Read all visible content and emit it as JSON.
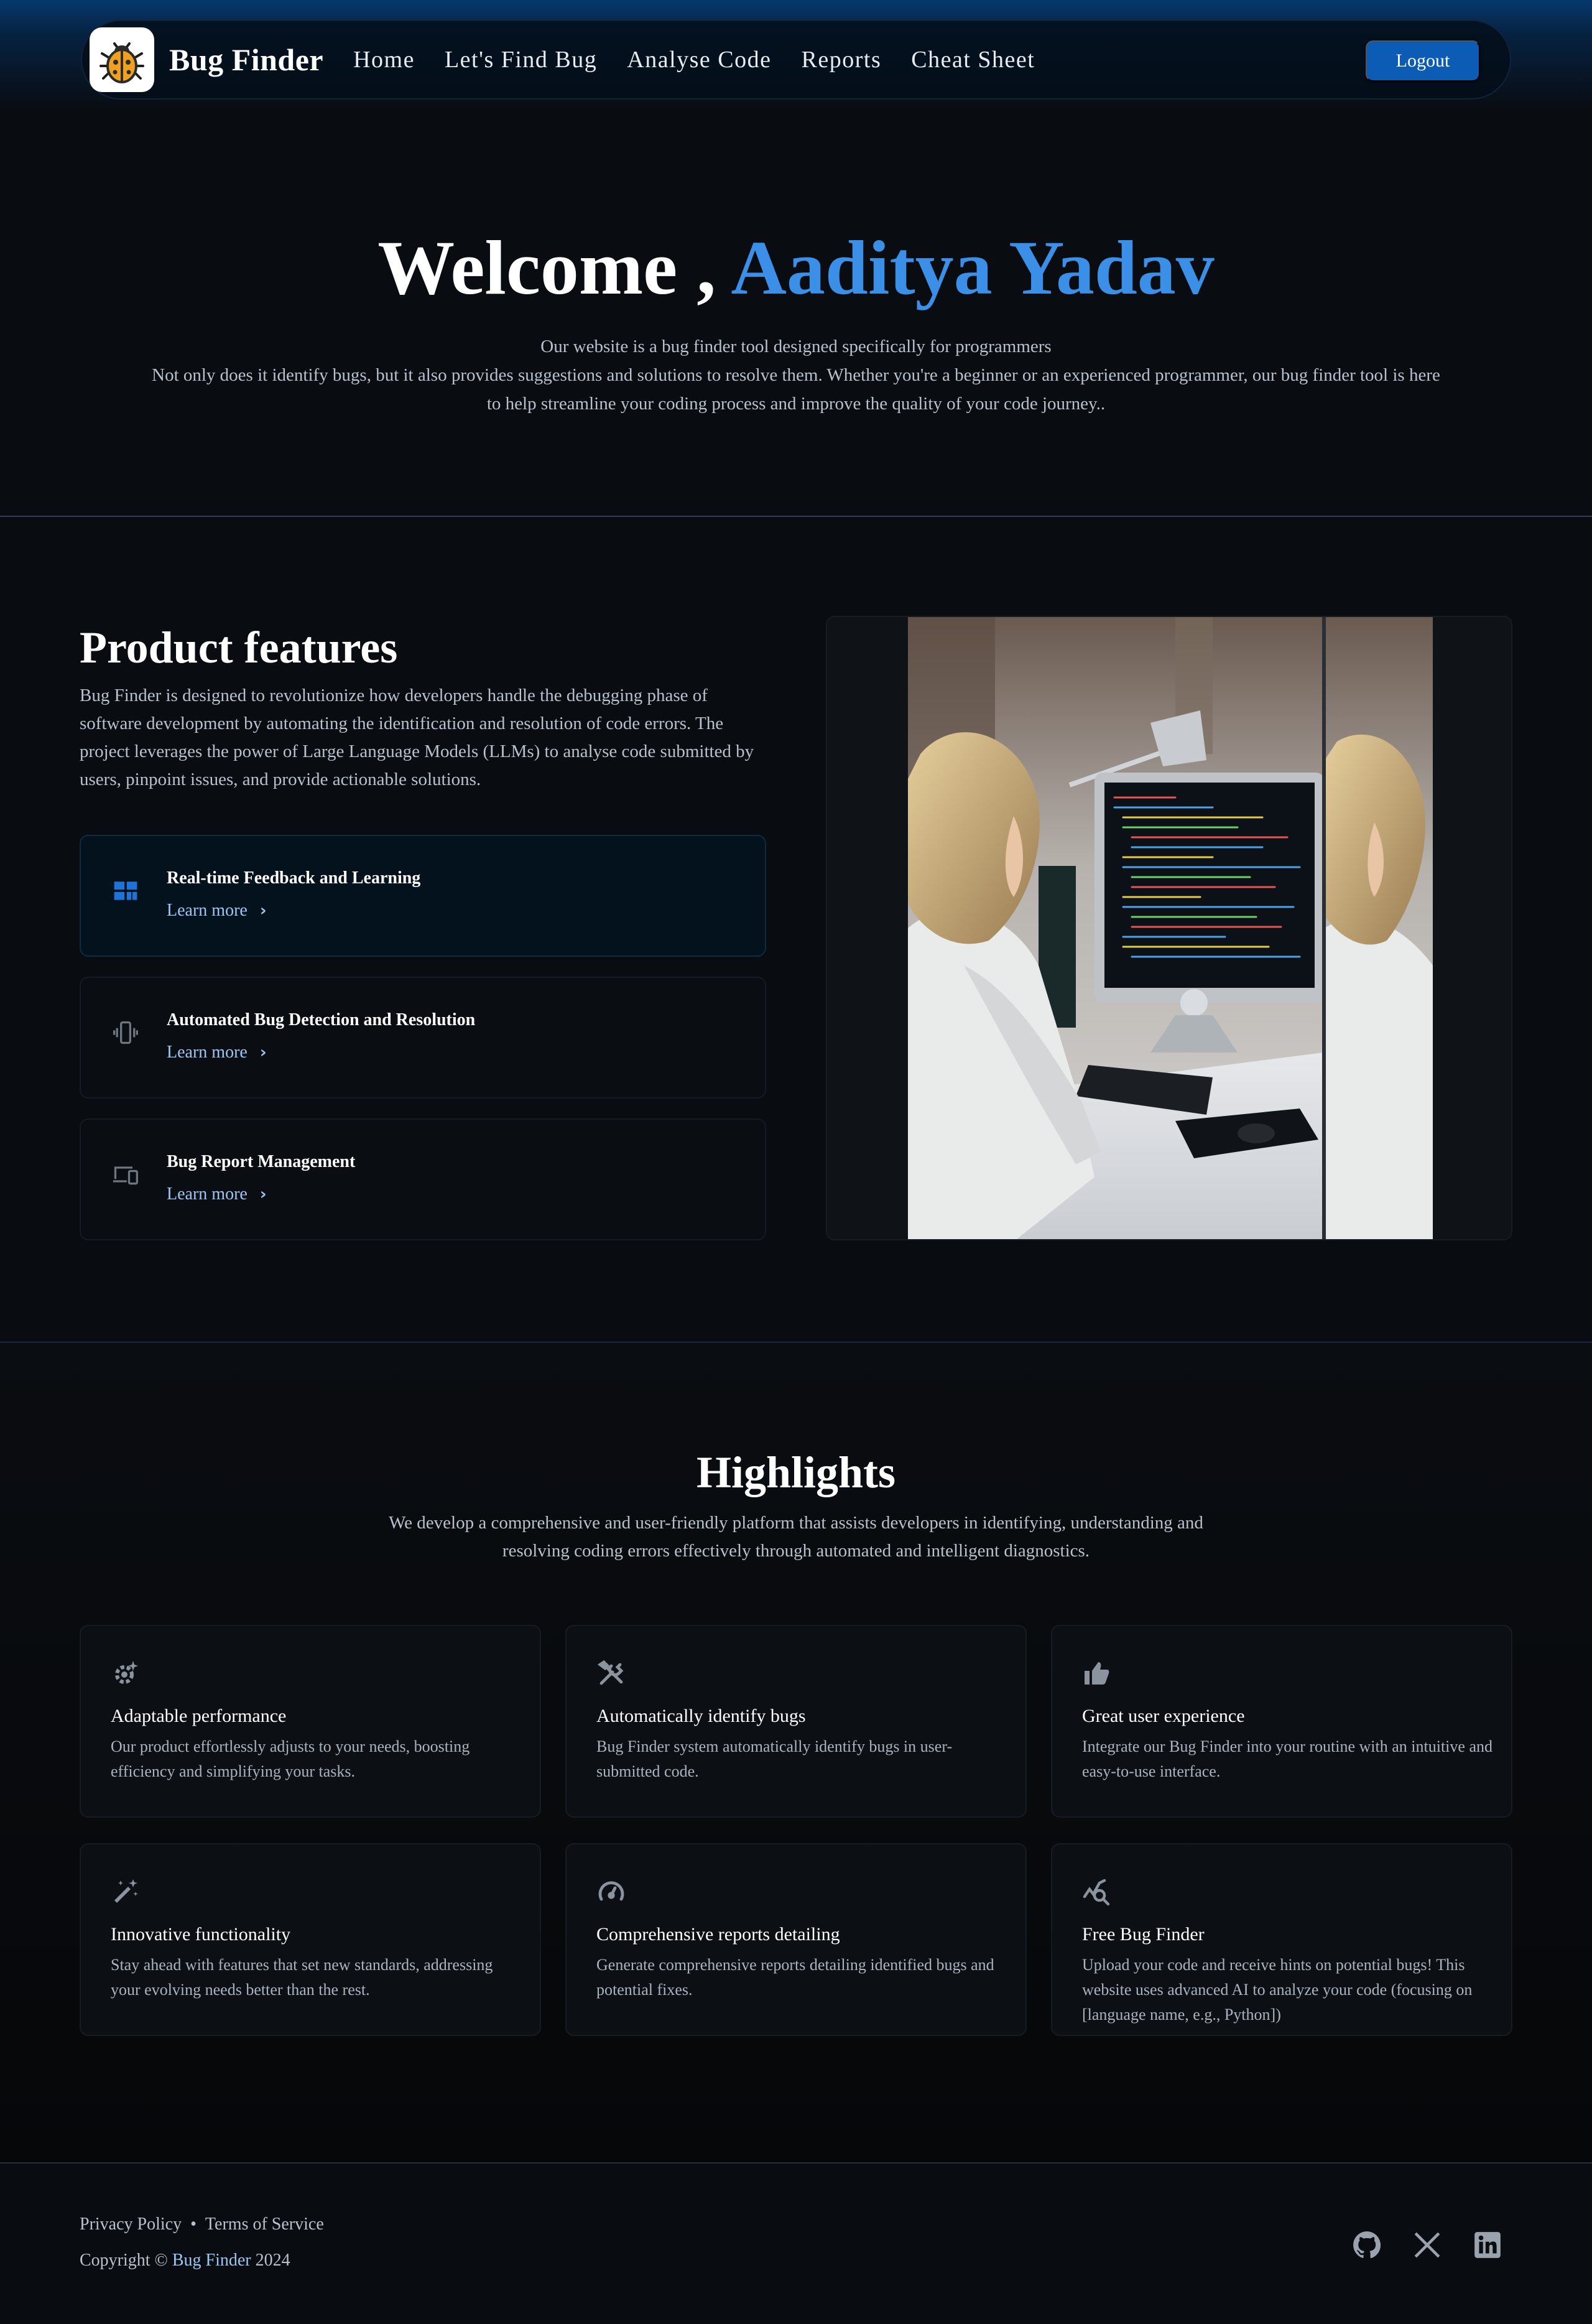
{
  "nav": {
    "brand": "Bug Finder",
    "links": [
      "Home",
      "Let's Find Bug",
      "Analyse Code",
      "Reports",
      "Cheat Sheet"
    ],
    "logout": "Logout",
    "logo_icon": "bug-icon"
  },
  "hero": {
    "welcome": "Welcome , ",
    "user_name": "Aaditya Yadav",
    "line1": "Our website is a bug finder tool designed specifically for programmers",
    "line2": "Not only does it identify bugs, but it also provides suggestions and solutions to resolve them. Whether you're a beginner or an experienced programmer, our bug finder tool is here to help streamline your coding process and improve the quality of your code journey.."
  },
  "features": {
    "title": "Product features",
    "description": "Bug Finder is designed to revolutionize how developers handle the debugging phase of software development by automating the identification and resolution of code errors. The project leverages the power of Large Language Models (LLMs) to analyse code submitted by users, pinpoint issues, and provide actionable solutions.",
    "items": [
      {
        "title": "Real-time Feedback and Learning",
        "link": "Learn more",
        "icon": "dashboard-icon",
        "active": true
      },
      {
        "title": "Automated Bug Detection and Resolution",
        "link": "Learn more",
        "icon": "vibrating-phone-icon",
        "active": false
      },
      {
        "title": "Bug Report Management",
        "link": "Learn more",
        "icon": "devices-icon",
        "active": false
      }
    ]
  },
  "highlights": {
    "title": "Highlights",
    "description": "We develop a comprehensive and user-friendly platform that assists developers in identifying, understanding and resolving coding errors effectively through automated and intelligent diagnostics.",
    "items": [
      {
        "title": "Adaptable performance",
        "text": "Our product effortlessly adjusts to your needs, boosting efficiency and simplifying your tasks.",
        "icon": "settings-suggest-icon"
      },
      {
        "title": "Automatically identify bugs",
        "text": "Bug Finder system automatically identify bugs in user-submitted code.",
        "icon": "tools-icon"
      },
      {
        "title": "Great user experience",
        "text": "Integrate our Bug Finder into your routine with an intuitive and easy-to-use interface.",
        "icon": "thumbs-up-icon"
      },
      {
        "title": "Innovative functionality",
        "text": "Stay ahead with features that set new standards, addressing your evolving needs better than the rest.",
        "icon": "magic-wand-icon"
      },
      {
        "title": "Comprehensive reports detailing",
        "text": "Generate comprehensive reports detailing identified bugs and potential fixes.",
        "icon": "speedometer-icon"
      },
      {
        "title": "Free Bug Finder",
        "text": "Upload your code and receive hints on potential bugs! This website uses advanced AI to analyze your code (focusing on [language name, e.g., Python])",
        "icon": "query-stats-icon"
      }
    ]
  },
  "footer": {
    "privacy": "Privacy Policy",
    "separator": "•",
    "terms": "Terms of Service",
    "copyright_prefix": "Copyright © ",
    "copyright_brand": "Bug Finder",
    "copyright_year": " 2024",
    "social": [
      "github-icon",
      "x-icon",
      "linkedin-icon"
    ]
  },
  "colors": {
    "accent": "#3b8fe6",
    "button": "#0c5bb5",
    "link": "#9ec6f3",
    "background": "#090c10"
  }
}
